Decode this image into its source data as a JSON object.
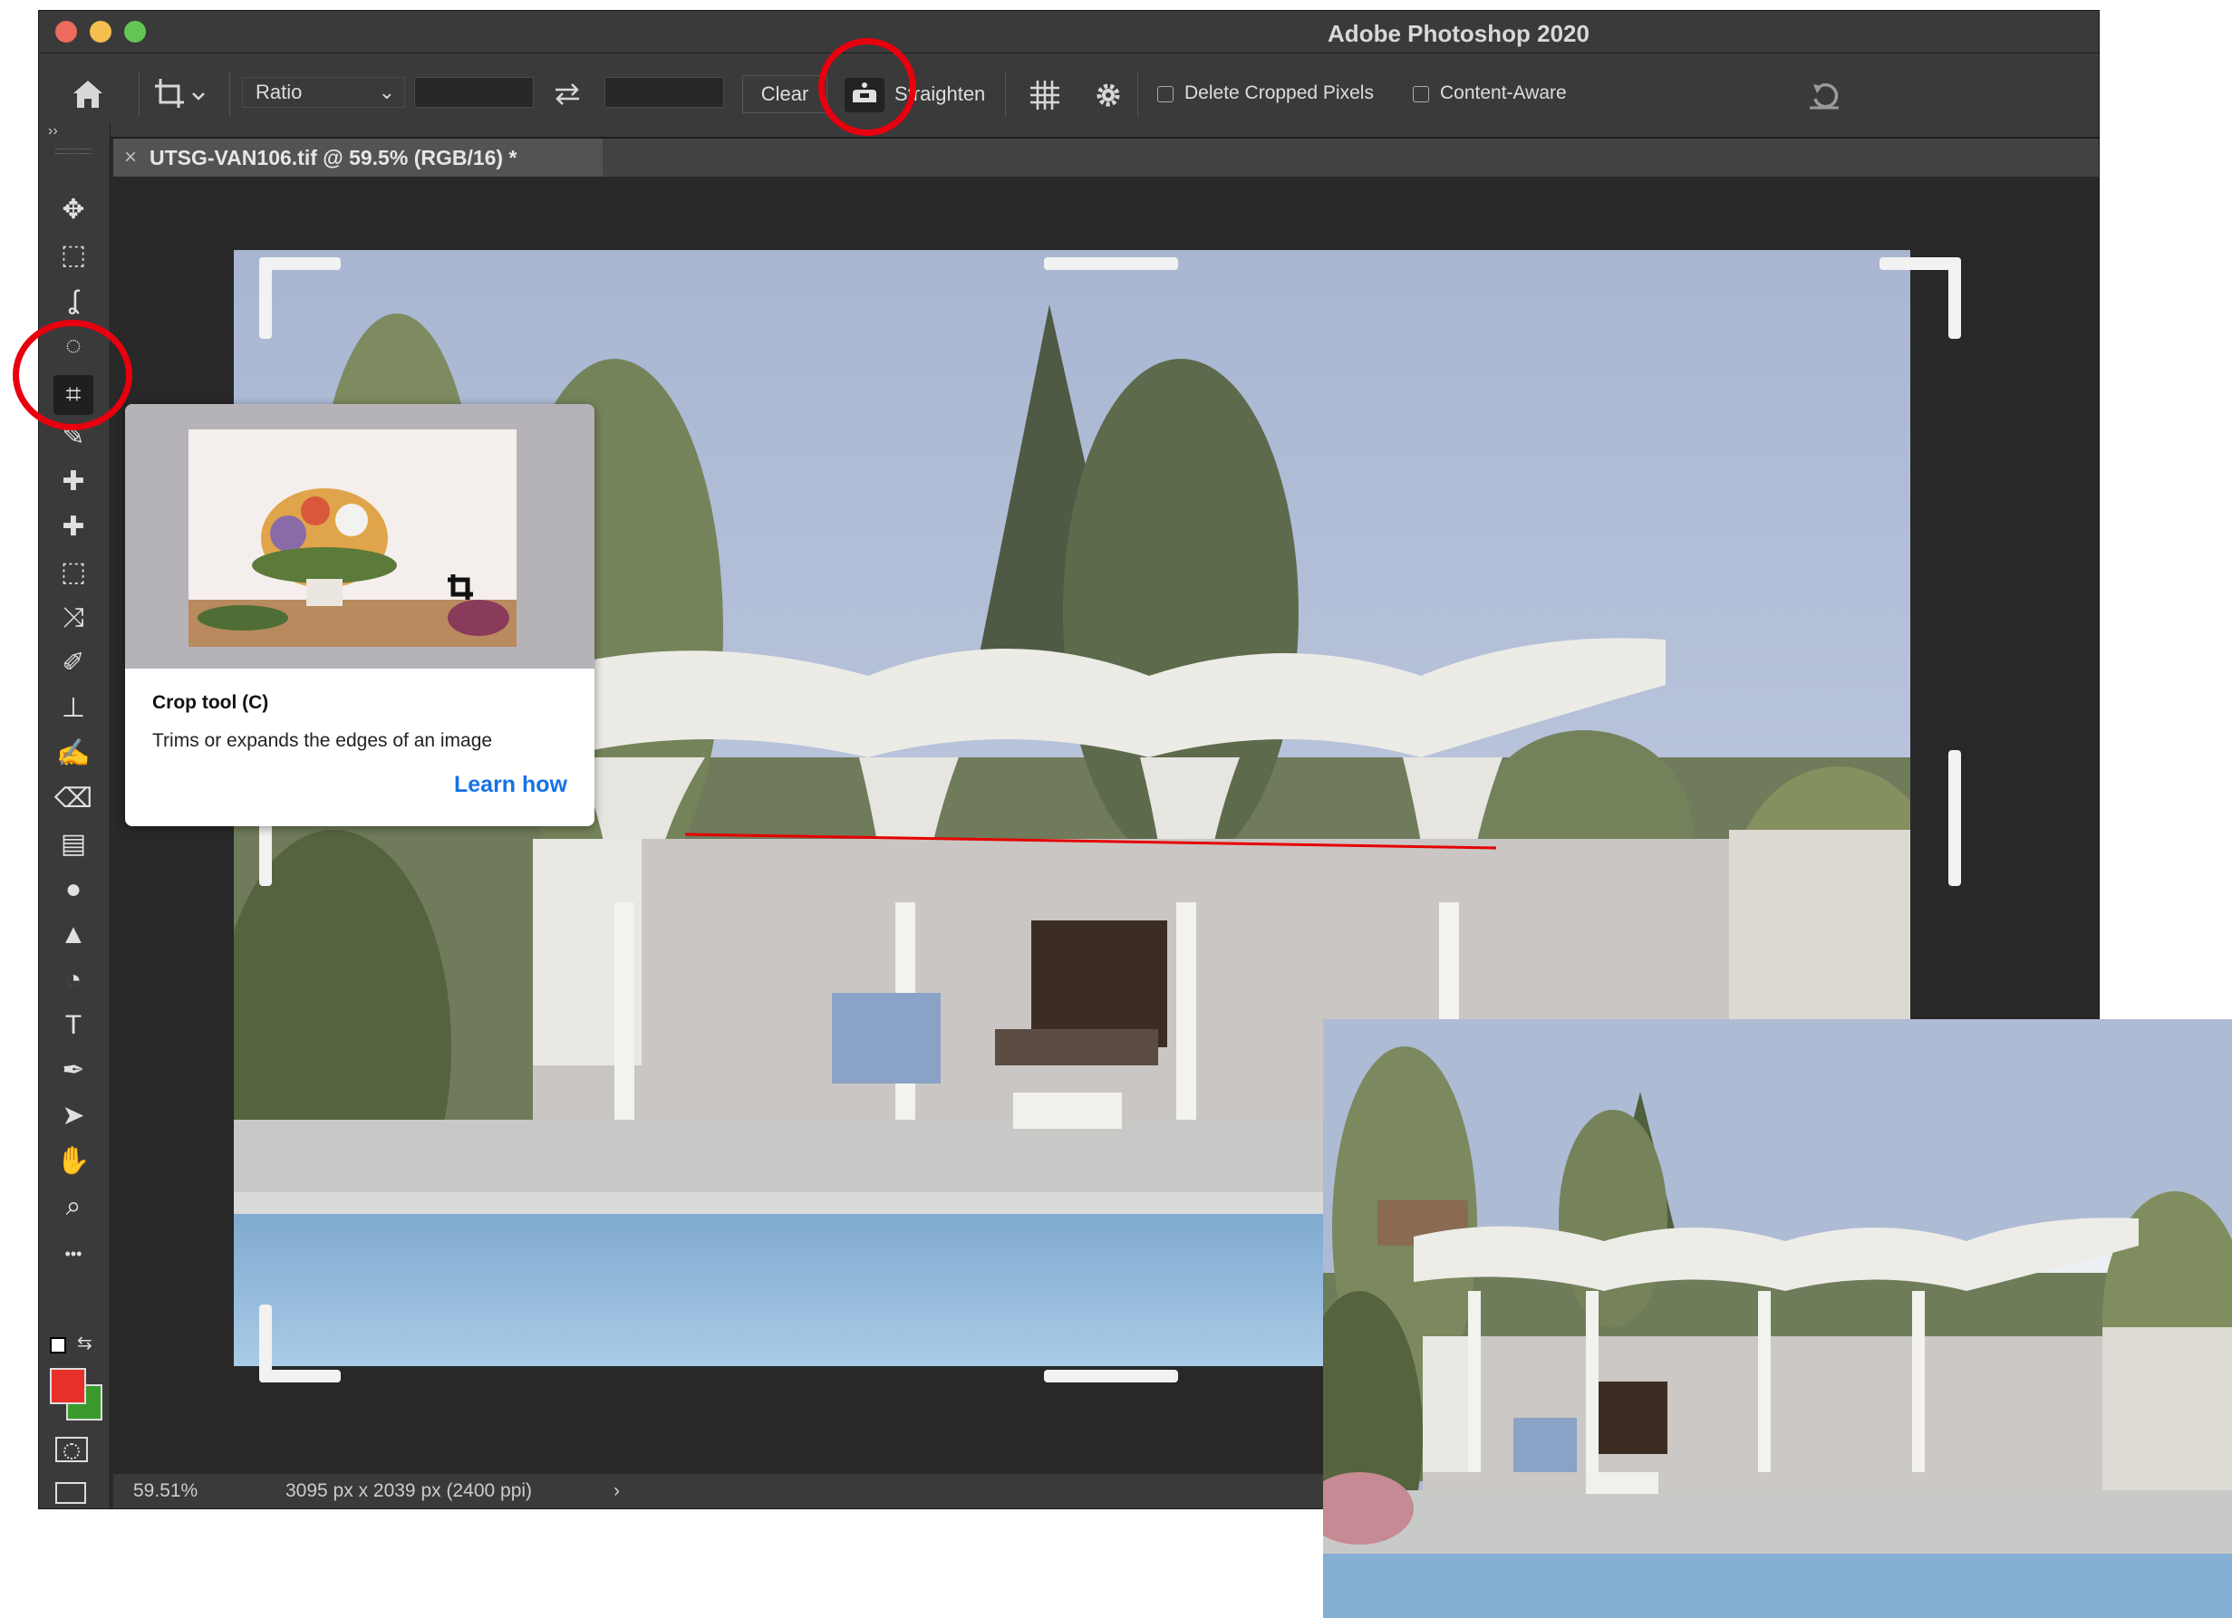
{
  "window": {
    "title": "Adobe Photoshop 2020"
  },
  "options_bar": {
    "ratio_value": "Ratio",
    "width_value": "",
    "height_value": "",
    "clear_label": "Clear",
    "straighten_label": "Straighten",
    "delete_cropped_label": "Delete Cropped Pixels",
    "delete_cropped_checked": false,
    "content_aware_label": "Content-Aware",
    "content_aware_checked": false
  },
  "document_tab": {
    "title": "UTSG-VAN106.tif @ 59.5% (RGB/16) *",
    "close": "×"
  },
  "tooltip": {
    "title": "Crop tool (C)",
    "description": "Trims or expands the edges of an image",
    "link": "Learn how"
  },
  "status_bar": {
    "zoom": "59.51%",
    "doc_info": "3095 px x 2039 px (2400 ppi)",
    "arrow": "›"
  },
  "toolbar": {
    "expand": "››",
    "tools": [
      "move-icon",
      "marquee-icon",
      "lasso-icon",
      "quick-selection-icon",
      "crop-icon",
      "eyedropper-icon",
      "spot-healing-icon",
      "healing-icon",
      "patch-icon",
      "content-aware-move-icon",
      "brush-icon",
      "stamp-icon",
      "history-brush-icon",
      "eraser-icon",
      "gradient-icon",
      "blur-icon",
      "sharpen-icon",
      "dodge-icon",
      "type-icon",
      "pen-icon",
      "path-selection-icon",
      "hand-icon",
      "zoom-icon",
      "more-tools-icon"
    ],
    "foreground_color": "#e8302a",
    "background_color": "#3a9a2e"
  },
  "colors": {
    "annotation_red": "#e8000e",
    "link_blue": "#1473e6"
  }
}
